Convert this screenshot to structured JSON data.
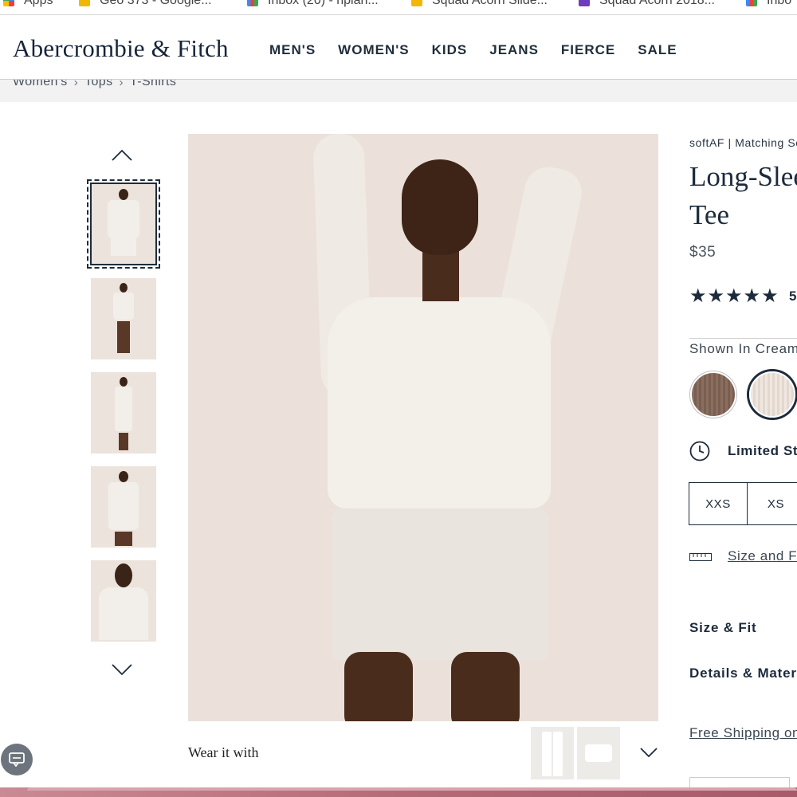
{
  "bookmarks": [
    {
      "icon": "apps-icon",
      "label": "Apps"
    },
    {
      "icon": "folder-icon",
      "label": "Geo 373 - Google..."
    },
    {
      "icon": "gmail-icon",
      "label": "Inbox (20) - nplan..."
    },
    {
      "icon": "folder-icon",
      "label": "Squad Acorn Slide..."
    },
    {
      "icon": "classroom-icon",
      "label": "Squad Acorn 2018..."
    },
    {
      "icon": "gmail-icon",
      "label": "Inbo"
    }
  ],
  "header": {
    "logo": "Abercrombie & Fitch",
    "nav": [
      "MEN'S",
      "WOMEN'S",
      "KIDS",
      "JEANS",
      "FIERCE",
      "SALE"
    ]
  },
  "breadcrumb": [
    "Women's",
    "Tops",
    "T-Shirts"
  ],
  "product": {
    "collection": "softAF | Matching Sets",
    "title_line1": "Long-Sleeve",
    "title_line2": "Tee",
    "price": "$35",
    "rating_count": "5",
    "shown_in": "Shown In Cream",
    "swatches": [
      {
        "name": "brown",
        "color": "#7f6456",
        "selected": false
      },
      {
        "name": "cream",
        "color": "#ebe2da",
        "selected": true
      }
    ],
    "stock_status": "Limited Stock",
    "sizes": [
      "XXS",
      "XS"
    ],
    "size_link": "Size and Fit",
    "accordions": [
      "Size & Fit",
      "Details & Materials"
    ],
    "shipping_link": "Free Shipping on"
  },
  "gallery": {
    "thumbnail_count": 5,
    "selected_index": 0
  },
  "wear_it_with": {
    "label": "Wear it with"
  },
  "colors": {
    "navy": "#1c2b3c",
    "photo_background": "#ebe1da"
  }
}
